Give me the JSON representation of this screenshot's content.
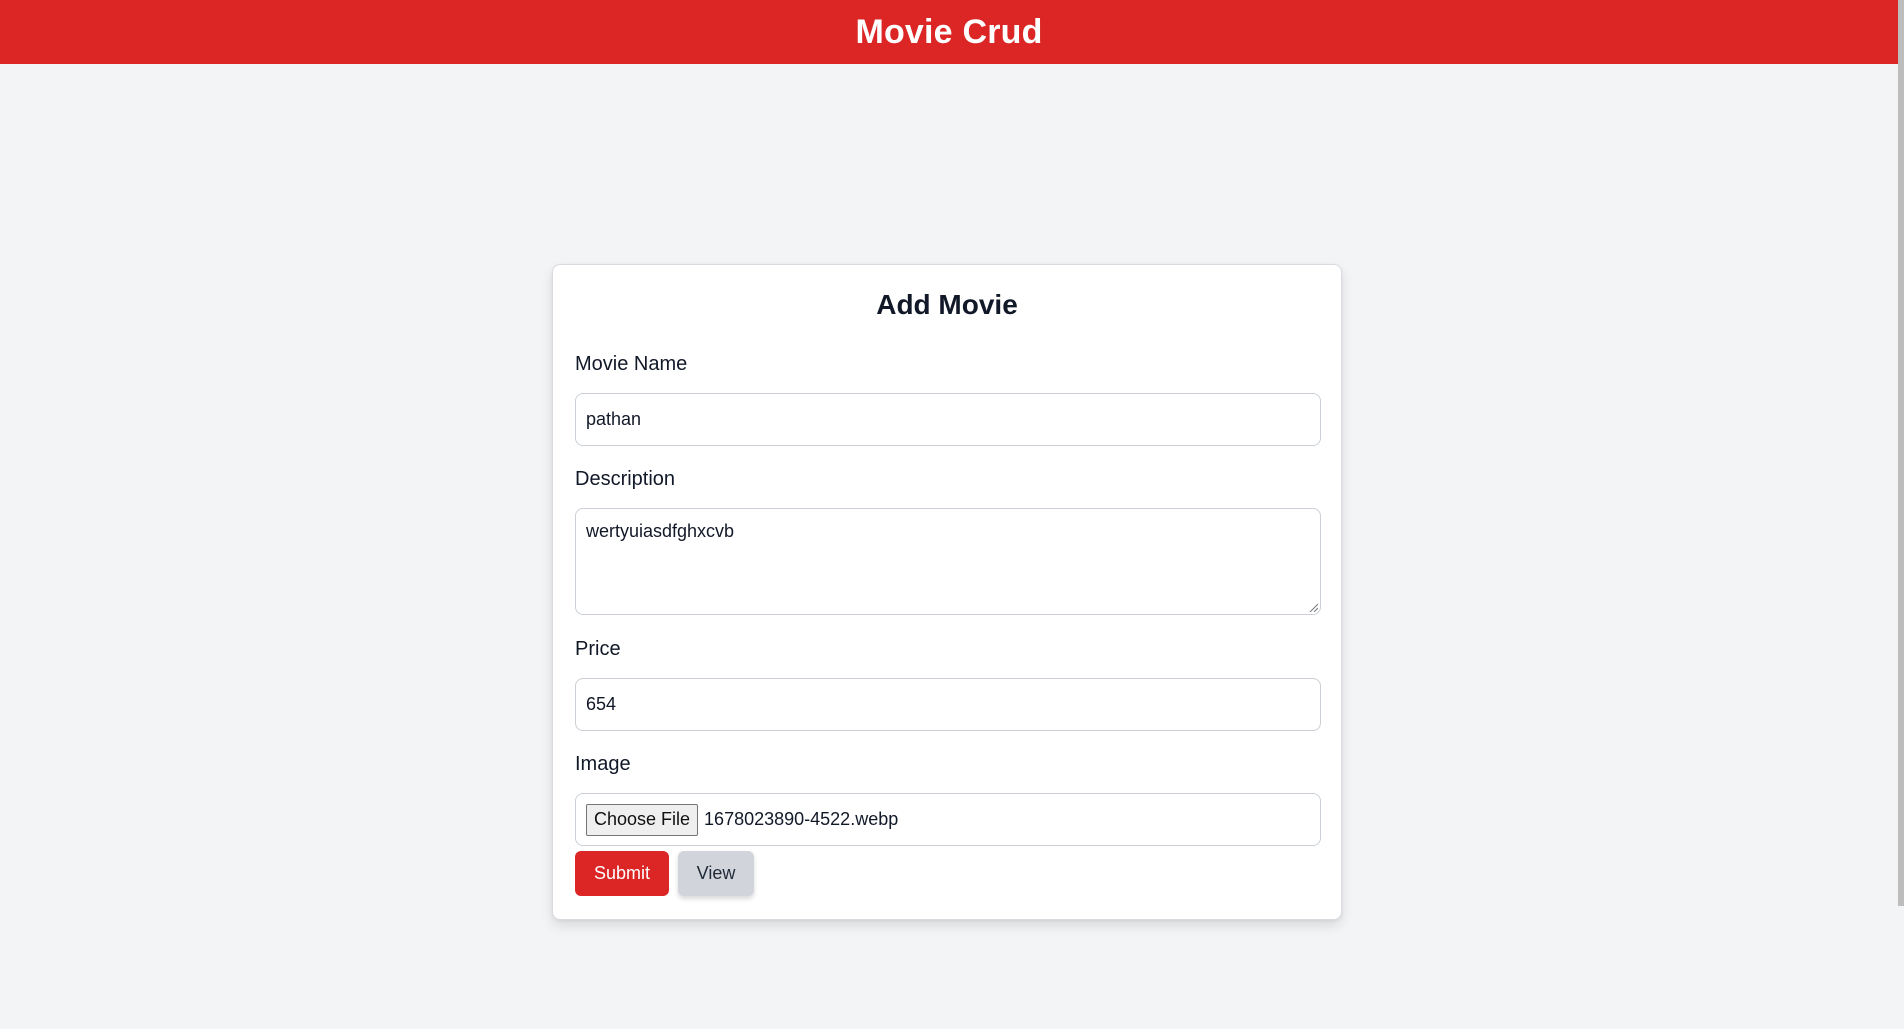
{
  "header": {
    "title": "Movie Crud"
  },
  "form": {
    "title": "Add Movie",
    "movie_name": {
      "label": "Movie Name",
      "value": "pathan"
    },
    "description": {
      "label": "Description",
      "value": "wertyuiasdfghxcvb"
    },
    "price": {
      "label": "Price",
      "value": "654"
    },
    "image": {
      "label": "Image",
      "button_label": "Choose File",
      "file_name": "1678023890-4522.webp"
    },
    "submit_label": "Submit",
    "view_label": "View"
  },
  "colors": {
    "accent": "#dc2626",
    "page_background": "#f3f4f6",
    "secondary_button": "#d1d5db"
  }
}
